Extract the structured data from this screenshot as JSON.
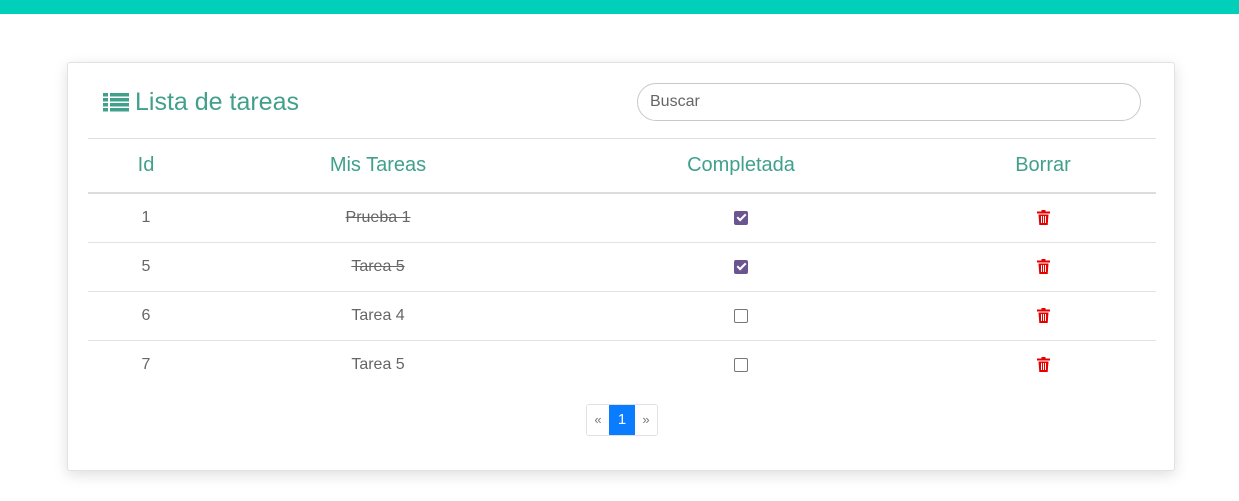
{
  "header": {
    "title": "Lista de tareas",
    "search_placeholder": "Buscar"
  },
  "table": {
    "columns": [
      "Id",
      "Mis Tareas",
      "Completada",
      "Borrar"
    ],
    "rows": [
      {
        "id": "1",
        "task": "Prueba 1",
        "completed": true
      },
      {
        "id": "5",
        "task": "Tarea 5",
        "completed": true
      },
      {
        "id": "6",
        "task": "Tarea 4",
        "completed": false
      },
      {
        "id": "7",
        "task": "Tarea 5",
        "completed": false
      }
    ]
  },
  "pagination": {
    "prev": "«",
    "current": "1",
    "next": "»"
  },
  "colors": {
    "accent_bar": "#00d0b9",
    "heading": "#41a08c",
    "checkbox_checked": "#6b5590",
    "delete_icon": "#e60000",
    "page_active": "#0a7cff"
  },
  "icons": {
    "title": "list-icon",
    "delete": "trash-icon"
  }
}
